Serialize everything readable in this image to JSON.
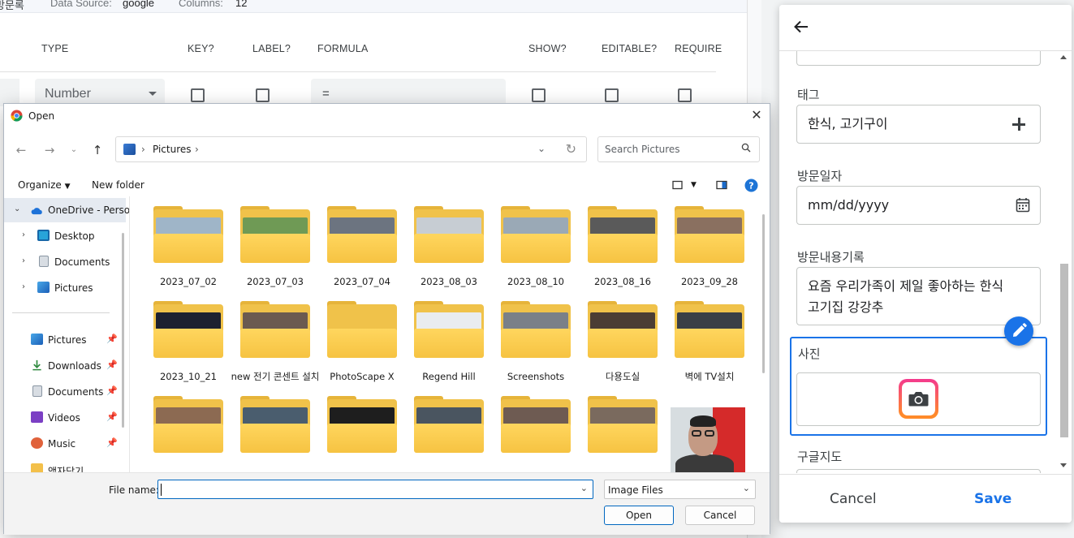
{
  "background": {
    "topbar": {
      "sheet": "방문록",
      "data_source_label": "Data Source:",
      "data_source": "google",
      "columns_label": "Columns:",
      "columns": "12"
    },
    "headers": [
      "TYPE",
      "KEY?",
      "LABEL?",
      "FORMULA",
      "SHOW?",
      "EDITABLE?",
      "REQUIRE"
    ],
    "row": {
      "type_value": "Number",
      "formula_value": "="
    }
  },
  "dialog": {
    "title": "Open",
    "close_glyph": "✕",
    "address": {
      "crumb": "Pictures"
    },
    "search_placeholder": "Search Pictures",
    "toolbar": {
      "organize": "Organize",
      "new_folder": "New folder"
    },
    "nav": [
      {
        "label": "OneDrive - Personal",
        "icon": "cloud-icon"
      },
      {
        "label": "Desktop",
        "icon": "desktop-icon"
      },
      {
        "label": "Documents",
        "icon": "documents-icon"
      },
      {
        "label": "Pictures",
        "icon": "pictures-icon"
      },
      {
        "label": "Pictures",
        "icon": "pictures-icon"
      },
      {
        "label": "Downloads",
        "icon": "downloads-icon"
      },
      {
        "label": "Documents",
        "icon": "documents-icon"
      },
      {
        "label": "Videos",
        "icon": "videos-icon"
      },
      {
        "label": "Music",
        "icon": "music-icon"
      },
      {
        "label": "액자담기",
        "icon": "folder-icon"
      }
    ],
    "folders": [
      {
        "name": "2023_07_02",
        "thumb": "#9fb5c8"
      },
      {
        "name": "2023_07_03",
        "thumb": "#6f9a55"
      },
      {
        "name": "2023_07_04",
        "thumb": "#6c7480"
      },
      {
        "name": "2023_08_03",
        "thumb": "#c7cdd3"
      },
      {
        "name": "2023_08_10",
        "thumb": "#9aa9b6"
      },
      {
        "name": "2023_08_16",
        "thumb": "#5a5a5a"
      },
      {
        "name": "2023_09_28",
        "thumb": "#8a7060"
      },
      {
        "name": "2023_10_21",
        "thumb": "#1d2130"
      },
      {
        "name": "new 전기 콘센트 설치",
        "thumb": "#6b5a50"
      },
      {
        "name": "PhotoScape X",
        "thumb": ""
      },
      {
        "name": "Regend Hill",
        "thumb": "#e9ecef"
      },
      {
        "name": "Screenshots",
        "thumb": "#7a8088"
      },
      {
        "name": "다용도실",
        "thumb": "#4b3d34"
      },
      {
        "name": "벽에 TV설치",
        "thumb": "#3a3f46"
      },
      {
        "name": "",
        "thumb": "#8c6a52"
      },
      {
        "name": "",
        "thumb": "#4a5d6e"
      },
      {
        "name": "",
        "thumb": "#1e1e1e"
      },
      {
        "name": "",
        "thumb": "#4a5560"
      },
      {
        "name": "",
        "thumb": "#6e5b52"
      },
      {
        "name": "",
        "thumb": "#7a6a5e"
      }
    ],
    "file_name_label": "File name:",
    "file_name_value": "",
    "filter_value": "Image Files",
    "open_button": "Open",
    "cancel_button": "Cancel"
  },
  "panel": {
    "fields": {
      "tag_label": "태그",
      "tag_value": "한식, 고기구이",
      "date_label": "방문일자",
      "date_value": "mm/dd/yyyy",
      "note_label": "방문내용기록",
      "note_line1": "요즘 우리가족이 제일 좋아하는 한식",
      "note_line2": "고기집 강강추",
      "photo_label": "사진",
      "map_label": "구글지도"
    },
    "cancel": "Cancel",
    "save": "Save"
  }
}
